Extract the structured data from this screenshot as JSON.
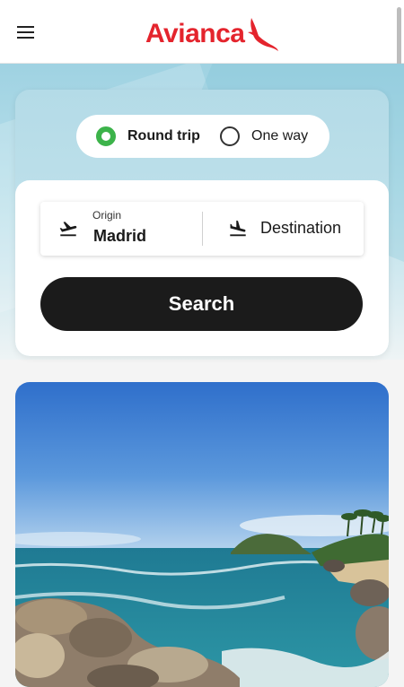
{
  "header": {
    "menu_icon": "hamburger-menu-icon",
    "brand": "Avianca",
    "brand_color": "#e4242d"
  },
  "search": {
    "trip_type": {
      "round_trip_label": "Round trip",
      "one_way_label": "One way",
      "selected": "round_trip",
      "accent_color": "#3cb34a"
    },
    "origin": {
      "label": "Origin",
      "value": "Madrid",
      "icon": "plane-takeoff-icon"
    },
    "destination": {
      "placeholder": "Destination",
      "icon": "plane-landing-icon"
    },
    "search_button_label": "Search"
  },
  "promo": {
    "image": "tropical beach with rocks and turquoise sea"
  }
}
